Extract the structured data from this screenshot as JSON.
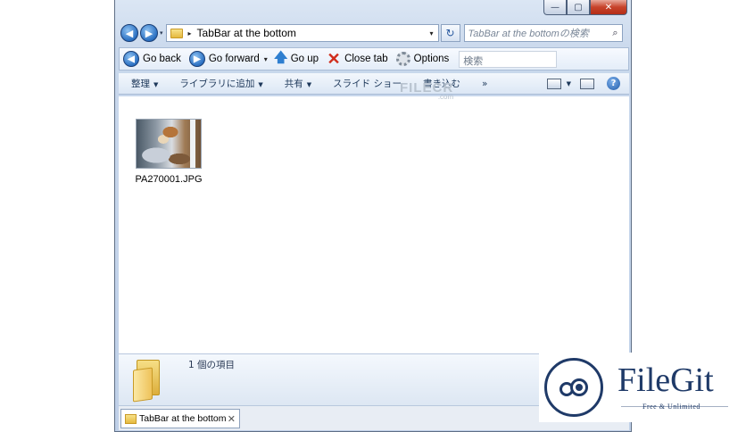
{
  "window": {
    "caption_buttons": {
      "minimize": "—",
      "maximize": "▢",
      "close": "✕"
    }
  },
  "address_bar": {
    "back_glyph": "◀",
    "forward_glyph": "▶",
    "breadcrumb_arrow": "▸",
    "path": "TabBar at the bottom",
    "dropdown_glyph": "▾",
    "refresh_glyph": "↻",
    "search_placeholder": "TabBar at the bottomの検索",
    "search_icon": "⌕"
  },
  "toolbar": {
    "go_back": "Go back",
    "go_forward": "Go forward",
    "go_up": "Go up",
    "close_tab": "Close tab",
    "options": "Options",
    "search_field": "検索",
    "icons": {
      "back": "◀",
      "forward": "▶",
      "up": "🡅",
      "close": "✕"
    }
  },
  "command_bar": {
    "organize": "整理",
    "add_to_library": "ライブラリに追加",
    "share": "共有",
    "slideshow": "スライド ショー",
    "burn": "書き込む",
    "more": "»",
    "help_glyph": "?"
  },
  "watermark": {
    "text": "FILECR",
    "suffix": ".com"
  },
  "files": [
    {
      "name": "PA270001.JPG",
      "type": "jpg-thumbnail"
    }
  ],
  "details_pane": {
    "item_count": "1 個の項目"
  },
  "tabs": [
    {
      "label": "TabBar at the bottom",
      "close": "✕"
    }
  ],
  "badge": {
    "name": "FileGit",
    "tagline": "Free & Unlimited",
    "color": "#1f3a68"
  }
}
